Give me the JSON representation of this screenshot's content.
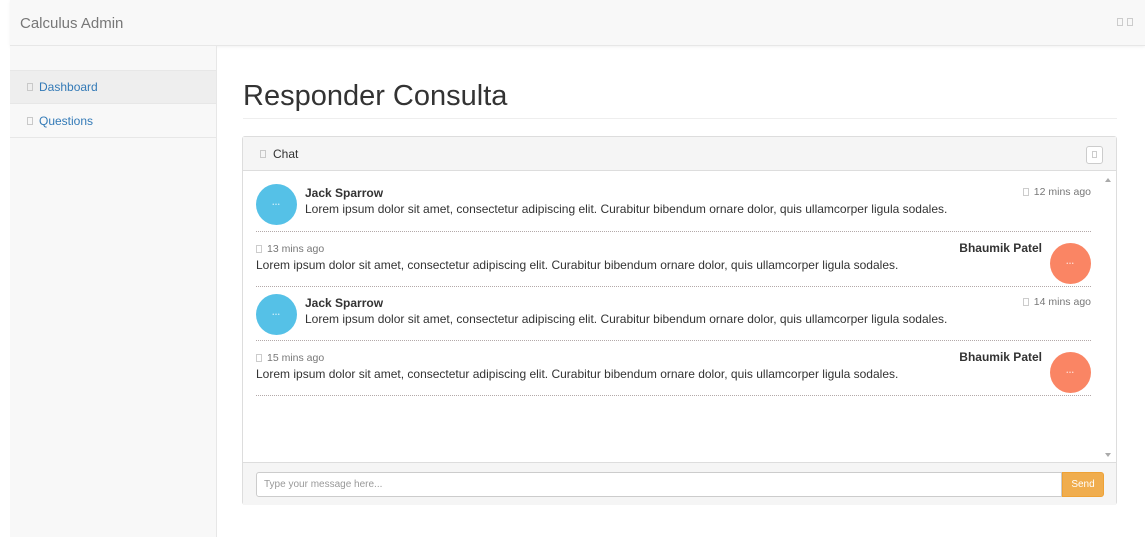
{
  "app": {
    "brand": "Calculus Admin"
  },
  "sidebar": {
    "items": [
      {
        "label": "Dashboard"
      },
      {
        "label": "Questions"
      }
    ]
  },
  "page": {
    "title": "Responder Consulta"
  },
  "chat": {
    "panel_title": "Chat",
    "messages": [
      {
        "side": "left",
        "author": "Jack Sparrow",
        "time": "12 mins ago",
        "text": "Lorem ipsum dolor sit amet, consectetur adipiscing elit. Curabitur bibendum ornare dolor, quis ullamcorper ligula sodales."
      },
      {
        "side": "right",
        "author": "Bhaumik Patel",
        "time": "13 mins ago",
        "text": "Lorem ipsum dolor sit amet, consectetur adipiscing elit. Curabitur bibendum ornare dolor, quis ullamcorper ligula sodales."
      },
      {
        "side": "left",
        "author": "Jack Sparrow",
        "time": "14 mins ago",
        "text": "Lorem ipsum dolor sit amet, consectetur adipiscing elit. Curabitur bibendum ornare dolor, quis ullamcorper ligula sodales."
      },
      {
        "side": "right",
        "author": "Bhaumik Patel",
        "time": "15 mins ago",
        "text": "Lorem ipsum dolor sit amet, consectetur adipiscing elit. Curabitur bibendum ornare dolor, quis ullamcorper ligula sodales."
      }
    ],
    "input_placeholder": "Type your message here...",
    "send_label": "Send"
  },
  "colors": {
    "left_avatar": "#55c1e7",
    "right_avatar": "#fa8564",
    "send_button": "#f0ad4e",
    "link": "#337ab7"
  }
}
